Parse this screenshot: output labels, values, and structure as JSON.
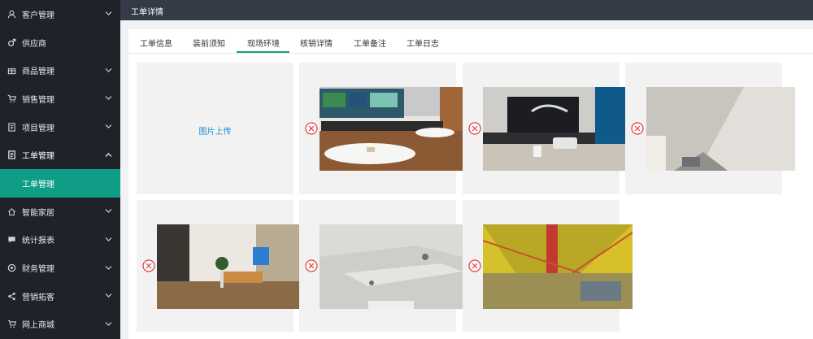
{
  "sidebar": {
    "items": [
      {
        "label": "客户管理",
        "icon": "user-icon"
      },
      {
        "label": "供应商",
        "icon": "male-icon"
      },
      {
        "label": "商品管理",
        "icon": "gift-icon"
      },
      {
        "label": "销售管理",
        "icon": "cart-icon"
      },
      {
        "label": "项目管理",
        "icon": "document-icon"
      },
      {
        "label": "工单管理",
        "icon": "document-icon"
      },
      {
        "label": "工单管理",
        "icon": ""
      },
      {
        "label": "智能家居",
        "icon": "home-icon"
      },
      {
        "label": "统计报表",
        "icon": "message-icon"
      },
      {
        "label": "财务管理",
        "icon": "settings-icon"
      },
      {
        "label": "营销拓客",
        "icon": "share-icon"
      },
      {
        "label": "网上商城",
        "icon": "cart-icon"
      }
    ]
  },
  "header": {
    "title": "工单详情"
  },
  "tabs": [
    {
      "label": "工单信息"
    },
    {
      "label": "装前须知"
    },
    {
      "label": "现场环境"
    },
    {
      "label": "核销详情"
    },
    {
      "label": "工单备注"
    },
    {
      "label": "工单日志"
    }
  ],
  "upload": {
    "label": "图片上传"
  },
  "photos": [
    {
      "alt": "living room with tv"
    },
    {
      "alt": "room with projector screen"
    },
    {
      "alt": "room ceiling corner"
    },
    {
      "alt": "living room"
    },
    {
      "alt": "ceiling downlight"
    },
    {
      "alt": "construction site ceiling"
    }
  ],
  "colors": {
    "sidebar_bg": "#1f2329",
    "active_menu": "#0f9d86",
    "header_bg": "#343a46",
    "link": "#1e88d8",
    "tab_underline": "#1aa37a",
    "delete_icon": "#e23b3b"
  }
}
